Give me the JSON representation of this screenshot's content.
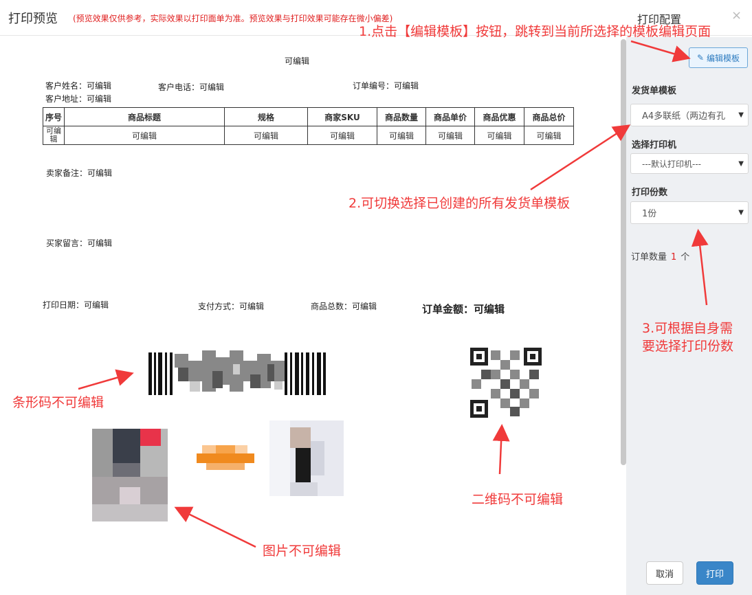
{
  "header": {
    "title": "打印预览",
    "note": "(预览效果仅供参考，实际效果以打印面单为准。预览效果与打印效果可能存在微小偏差)",
    "config_title": "打印配置",
    "close_symbol": "×"
  },
  "sidebar": {
    "edit_button": "编辑模板",
    "template_label": "发货单模板",
    "template_value": "A4多联纸（两边有孔",
    "printer_label": "选择打印机",
    "printer_value": "---默认打印机---",
    "copies_label": "打印份数",
    "copies_value": "1份",
    "order_count_label": "订单数量",
    "order_count_value": "1",
    "order_count_unit": "个",
    "cancel_button": "取消",
    "print_button": "打印"
  },
  "document": {
    "title": "可编辑",
    "customer_name": "客户姓名：可编辑",
    "customer_phone": "客户电话：可编辑",
    "order_no": "订单编号：可编辑",
    "customer_address": "客户地址：可编辑",
    "table": {
      "headers": [
        "序号",
        "商品标题",
        "规格",
        "商家SKU",
        "商品数量",
        "商品单价",
        "商品优惠",
        "商品总价"
      ],
      "row": [
        "可编辑",
        "可编辑",
        "可编辑",
        "可编辑",
        "可编辑",
        "可编辑",
        "可编辑",
        "可编辑"
      ]
    },
    "seller_note": "卖家备注：可编辑",
    "buyer_message": "买家留言：可编辑",
    "print_date": "打印日期：可编辑",
    "payment_method": "支付方式：可编辑",
    "total_items": "商品总数：可编辑",
    "order_amount": "订单金额：可编辑"
  },
  "annotations": {
    "a1": "1.点击【编辑模板】按钮，跳转到当前所选择的模板编辑页面",
    "a2": "2.可切换选择已创建的所有发货单模板",
    "a3_line1": "3.可根据自身需",
    "a3_line2": "要选择打印份数",
    "barcode": "条形码不可编辑",
    "image": "图片不可编辑",
    "qrcode": "二维码不可编辑"
  },
  "colors": {
    "annotation_red": "#f03a3a",
    "primary_blue": "#3a86c8",
    "sidebar_bg": "#eef0f3"
  }
}
